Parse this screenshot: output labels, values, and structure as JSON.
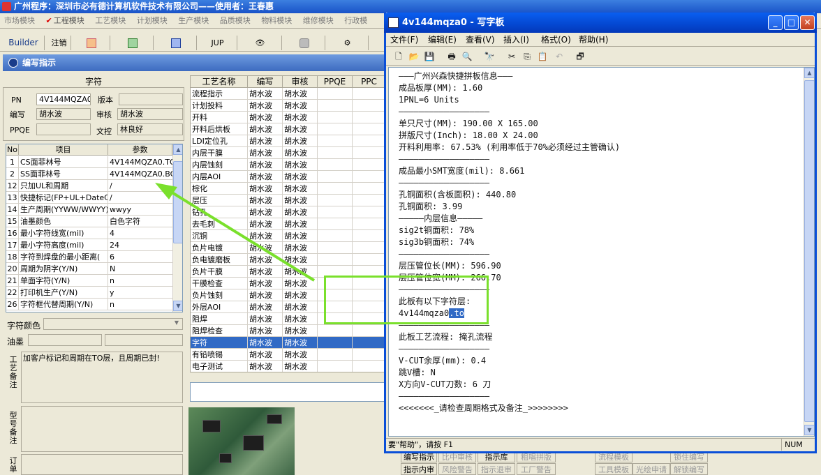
{
  "app": {
    "title": "广州程序：深圳市必有德计算机软件技术有限公司——使用者：王春惠",
    "modules": [
      "市场模块",
      "工程模块",
      "工艺模块",
      "计划模块",
      "生产模块",
      "品质模块",
      "物料模块",
      "维修模块",
      "行政模"
    ],
    "toolbar": {
      "builder": "Builder",
      "logout": "注销",
      "jup": "JUP"
    }
  },
  "panel": {
    "title": "编写指示",
    "char_group_title": "字符",
    "pn_label": "PN",
    "pn_value": "4V144MQZA0",
    "version_label": "版本",
    "version_value": "",
    "writer_label": "编写",
    "writer_value": "胡水波",
    "reviewer_label": "审核",
    "reviewer_value": "胡水波",
    "ppqe_label": "PPQE",
    "ppqe_value": "",
    "doc_ctrl_label": "文控",
    "doc_ctrl_value": "林良好"
  },
  "params": {
    "headers": [
      "No",
      "项目",
      "参数"
    ],
    "rows": [
      {
        "no": "1",
        "item": "CS面菲林号",
        "value": "4V144MQZA0.TO"
      },
      {
        "no": "2",
        "item": "SS面菲林号",
        "value": "4V144MQZA0.BO"
      },
      {
        "no": "12",
        "item": "只加UL和周期",
        "value": "/"
      },
      {
        "no": "13",
        "item": "快捷标记(FP+UL+DateCo",
        "value": "/"
      },
      {
        "no": "14",
        "item": "生产周期(YYWW/WWYY)",
        "value": "wwyy"
      },
      {
        "no": "15",
        "item": "油墨颜色",
        "value": "白色字符"
      },
      {
        "no": "16",
        "item": "最小字符线宽(mil)",
        "value": "4"
      },
      {
        "no": "17",
        "item": "最小字符高度(mil)",
        "value": "24"
      },
      {
        "no": "18",
        "item": "字符到焊盘的最小距离(",
        "value": "6"
      },
      {
        "no": "20",
        "item": "周期为阴字(Y/N)",
        "value": "N"
      },
      {
        "no": "21",
        "item": "单面字符(Y/N)",
        "value": "n"
      },
      {
        "no": "22",
        "item": "打印机生产(Y/N)",
        "value": "y"
      },
      {
        "no": "26",
        "item": "字符框代替周期(Y/N)",
        "value": "n"
      }
    ]
  },
  "char_color_label": "字符颜色",
  "ink_label": "油墨",
  "remarks": {
    "label": "工艺备注",
    "text": "加客户标记和周期在TO层，且周期已封!"
  },
  "model_remarks_label": "型号备注",
  "order_label": "订单",
  "process": {
    "headers": [
      "工艺名称",
      "编写",
      "审核",
      "PPQE",
      "PPC"
    ],
    "rows": [
      [
        "流程指示",
        "胡水波",
        "胡水波"
      ],
      [
        "计划投料",
        "胡水波",
        "胡水波"
      ],
      [
        "开料",
        "胡水波",
        "胡水波"
      ],
      [
        "开料后烘板",
        "胡水波",
        "胡水波"
      ],
      [
        "LDI定位孔",
        "胡水波",
        "胡水波"
      ],
      [
        "内层干膜",
        "胡水波",
        "胡水波"
      ],
      [
        "内层蚀刻",
        "胡水波",
        "胡水波"
      ],
      [
        "内层AOI",
        "胡水波",
        "胡水波"
      ],
      [
        "棕化",
        "胡水波",
        "胡水波"
      ],
      [
        "层压",
        "胡水波",
        "胡水波"
      ],
      [
        "钻孔",
        "胡水波",
        "胡水波"
      ],
      [
        "去毛刺",
        "胡水波",
        "胡水波"
      ],
      [
        "沉铜",
        "胡水波",
        "胡水波"
      ],
      [
        "负片电镀",
        "胡水波",
        "胡水波"
      ],
      [
        "负电镀磨板",
        "胡水波",
        "胡水波"
      ],
      [
        "负片干膜",
        "胡水波",
        "胡水波"
      ],
      [
        "干膜检查",
        "胡水波",
        "胡水波"
      ],
      [
        "负片蚀刻",
        "胡水波",
        "胡水波"
      ],
      [
        "外层AOI",
        "胡水波",
        "胡水波"
      ],
      [
        "阻焊",
        "胡水波",
        "胡水波"
      ],
      [
        "阻焊检查",
        "胡水波",
        "胡水波"
      ],
      [
        "字符",
        "胡水波",
        "胡水波"
      ],
      [
        "有铅喷锡",
        "胡水波",
        "胡水波"
      ],
      [
        "电子测试",
        "胡水波",
        "胡水波"
      ]
    ],
    "selected_index": 21
  },
  "bottom_buttons": [
    "编写指示",
    "比中审核",
    "指示库",
    "粗唱拼版",
    "流程模板",
    "锁住编写",
    "指示内审",
    "风险警告",
    "指示退审",
    "工厂警告",
    "工具模板",
    "光绘申请",
    "解锁编写"
  ],
  "wordpad": {
    "title": "4v144mqza0 - 写字板",
    "menu": [
      "文件(F)",
      "编辑(E)",
      "查看(V)",
      "插入(I)",
      "格式(O)",
      "帮助(H)"
    ],
    "lines": [
      "———广州兴森快捷拼板信息———",
      "成品板厚(MM): 1.60",
      "1PNL=6 Units",
      "——————————————————",
      "单只尺寸(MM): 190.00 X 165.00",
      "拼版尺寸(Inch): 18.00 X 24.00",
      "开料利用率: 67.53% (利用率低于70%必须经过主管确认)",
      "——————————————————",
      "成品最小SMT宽度(mil): 8.661",
      "——————————————————",
      "孔铜面积(含板面积): 440.80",
      "孔铜面积: 3.99",
      "—————内层信息—————",
      "sig2t铜面积: 78%",
      "sig3b铜面积: 74%",
      "——————————————————",
      "层压管位长(MM): 596.90",
      "层压管位宽(MM): 266.70",
      "——————————————————",
      "此板有以下字符层:",
      "4v144mqza0",
      "——————————————————",
      "此板工艺流程: 掩孔流程",
      "——————————————————",
      "V-CUT余厚(mm): 0.4",
      "跳V槽: N",
      "X方向V-CUT刀数: 6 刀",
      "——————————————————",
      "<<<<<<<_请检查周期格式及备注_>>>>>>>>"
    ],
    "highlight_suffix": ".to",
    "status": "要\"帮助\"，请按 F1",
    "num_indicator": "NUM"
  },
  "colors": {
    "xp_blue": "#0a4fd8",
    "selection": "#316ac5",
    "annotation_green": "#7ae02c"
  }
}
